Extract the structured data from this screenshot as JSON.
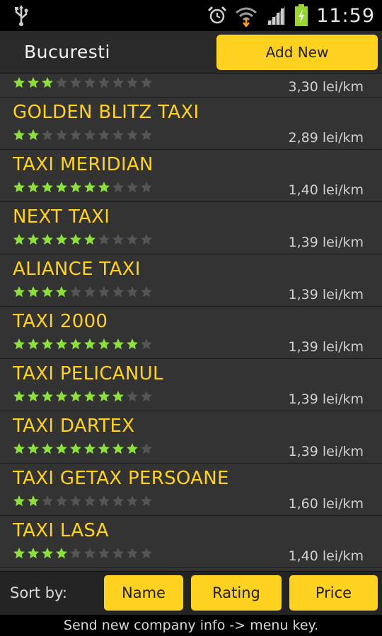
{
  "status_bar": {
    "time": "11:59",
    "icons": [
      "usb-icon",
      "alarm-icon",
      "wifi-icon",
      "signal-icon",
      "battery-charging-icon"
    ]
  },
  "header": {
    "city": "Bucuresti",
    "add_new_label": "Add New"
  },
  "colors": {
    "accent": "#ffd21f",
    "star_on": "#8de03a",
    "star_off": "#555555",
    "list_bg": "#333333"
  },
  "companies": [
    {
      "name": "",
      "rating": 3,
      "price": "3,30 lei/km"
    },
    {
      "name": "GOLDEN BLITZ TAXI",
      "rating": 2,
      "price": "2,89 lei/km"
    },
    {
      "name": "TAXI MERIDIAN",
      "rating": 7,
      "price": "1,40 lei/km"
    },
    {
      "name": "NEXT TAXI",
      "rating": 6,
      "price": "1,39 lei/km"
    },
    {
      "name": "ALIANCE TAXI",
      "rating": 4,
      "price": "1,39 lei/km"
    },
    {
      "name": "TAXI 2000",
      "rating": 9,
      "price": "1,39 lei/km"
    },
    {
      "name": "TAXI PELICANUL",
      "rating": 8,
      "price": "1,39 lei/km"
    },
    {
      "name": "TAXI DARTEX",
      "rating": 9,
      "price": "1,39 lei/km"
    },
    {
      "name": "TAXI GETAX PERSOANE",
      "rating": 2,
      "price": "1,60 lei/km"
    },
    {
      "name": "TAXI LASA",
      "rating": 4,
      "price": "1,40 lei/km"
    }
  ],
  "max_stars": 10,
  "sort": {
    "label": "Sort by:",
    "name_label": "Name",
    "rating_label": "Rating",
    "price_label": "Price"
  },
  "footer": {
    "hint": "Send new company info -> menu key."
  }
}
